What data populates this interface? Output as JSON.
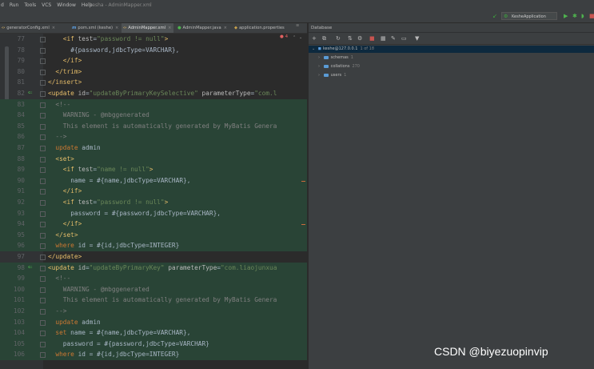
{
  "menu": {
    "items": [
      "d",
      "Run",
      "Tools",
      "VCS",
      "Window",
      "Help"
    ],
    "title": "kesha - AdminMapper.xml"
  },
  "toolbar": {
    "run_config": "KesheApplication"
  },
  "tabs": [
    {
      "label": "generatorConfig.xml",
      "active": false
    },
    {
      "label": "pom.xml (keshe)",
      "active": false
    },
    {
      "label": "AdminMapper.xml",
      "active": true
    },
    {
      "label": "AdminMapper.java",
      "active": false
    },
    {
      "label": "application.properties",
      "active": false
    }
  ],
  "editor": {
    "error_count": "4",
    "lines": [
      {
        "num": "77",
        "text": "<if test=\"password != null\">"
      },
      {
        "num": "78",
        "text": "#{password,jdbcType=VARCHAR},"
      },
      {
        "num": "79",
        "text": "</if>"
      },
      {
        "num": "80",
        "text": "</trim>"
      },
      {
        "num": "81",
        "text": "</insert>"
      },
      {
        "num": "82",
        "text": "<update id=\"updateByPrimaryKeySelective\" parameterType=\"com.l"
      },
      {
        "num": "83",
        "text": "<!--"
      },
      {
        "num": "84",
        "text": "WARNING - @mbggenerated"
      },
      {
        "num": "85",
        "text": "This element is automatically generated by MyBatis Genera"
      },
      {
        "num": "86",
        "text": "-->"
      },
      {
        "num": "87",
        "text": "update admin"
      },
      {
        "num": "88",
        "text": "<set>"
      },
      {
        "num": "89",
        "text": "<if test=\"name != null\">"
      },
      {
        "num": "90",
        "text": "name = #{name,jdbcType=VARCHAR},"
      },
      {
        "num": "91",
        "text": "</if>"
      },
      {
        "num": "92",
        "text": "<if test=\"password != null\">"
      },
      {
        "num": "93",
        "text": "password = #{password,jdbcType=VARCHAR},"
      },
      {
        "num": "94",
        "text": "</if>"
      },
      {
        "num": "95",
        "text": "</set>"
      },
      {
        "num": "96",
        "text": "where id = #{id,jdbcType=INTEGER}"
      },
      {
        "num": "97",
        "text": "</update>"
      },
      {
        "num": "98",
        "text": "<update id=\"updateByPrimaryKey\" parameterType=\"com.liaojunxua"
      },
      {
        "num": "99",
        "text": "<!--"
      },
      {
        "num": "100",
        "text": "WARNING - @mbggenerated"
      },
      {
        "num": "101",
        "text": "This element is automatically generated by MyBatis Genera"
      },
      {
        "num": "102",
        "text": "-->"
      },
      {
        "num": "103",
        "text": "update admin"
      },
      {
        "num": "104",
        "text": "set name = #{name,jdbcType=VARCHAR},"
      },
      {
        "num": "105",
        "text": "password = #{password,jdbcType=VARCHAR}"
      },
      {
        "num": "106",
        "text": "where id = #{id,jdbcType=INTEGER}"
      }
    ]
  },
  "database": {
    "title": "Database",
    "connection": "keshe@127.0.0.1",
    "connection_count": "1 of 18",
    "nodes": [
      {
        "label": "schemas",
        "count": "1"
      },
      {
        "label": "collations",
        "count": "270"
      },
      {
        "label": "users",
        "count": "1"
      }
    ]
  },
  "watermark": "CSDN @biyezuopinvip",
  "colors": {
    "bg": "#2b2b2b",
    "panel": "#3c3f41",
    "tag": "#e8bf6a",
    "string": "#6a8759",
    "comment": "#808080",
    "highlight": "#294436"
  }
}
